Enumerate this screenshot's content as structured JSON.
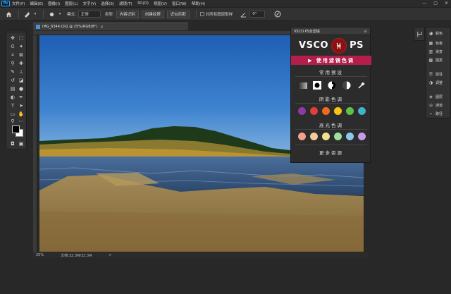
{
  "menubar": {
    "logo": "Ps",
    "items": [
      "文件(F)",
      "编辑(E)",
      "图像(I)",
      "图层(L)",
      "文字(Y)",
      "选择(S)",
      "滤镜(T)",
      "3D(D)",
      "视图(V)",
      "窗口(W)",
      "帮助(H)"
    ],
    "controls": [
      "—",
      "▢",
      "✕"
    ]
  },
  "options": {
    "mode_label": "模式:",
    "mode_value": "正常",
    "type_label": "类型:",
    "type_buttons": [
      "内容识别",
      "创建纹理",
      "近似匹配"
    ],
    "sample_all_label": "对所有图层取样",
    "angle_value": "0°"
  },
  "document": {
    "title": "IMG_6344.CR2 @ 25%(RGB/8*)",
    "close": "×",
    "zoom": "25%",
    "doc_info": "文档:32.3M/32.3M",
    "arrow": ">"
  },
  "vsco": {
    "tab_title": "VSCO PS全滤镜",
    "menu_icon": "≡",
    "brand_left": "VSCO",
    "brand_right": "PS",
    "use_button": "▶ 使用滤镜色调",
    "common_presets": "常用预设",
    "shadow_tones": "阴影色调",
    "highlight_tones": "高光色调",
    "more_resources": "更多资源",
    "shadow_colors": [
      "#8e3aa6",
      "#e53b3b",
      "#f06a1c",
      "#f5c518",
      "#5fc24a",
      "#3fb3c9"
    ],
    "highlight_colors": [
      "#f3a08d",
      "#f7c99a",
      "#f2e08a",
      "#9fe0a0",
      "#8cc8ea",
      "#c79be8"
    ]
  },
  "right_panel": {
    "items": [
      {
        "icon": "color-icon",
        "label": "颜色"
      },
      {
        "icon": "swatches-icon",
        "label": "色板"
      },
      {
        "icon": "gradients-icon",
        "label": "渐变"
      },
      {
        "icon": "patterns-icon",
        "label": "图案"
      },
      {
        "icon": "properties-icon",
        "label": "属性"
      },
      {
        "icon": "adjustments-icon",
        "label": "调整"
      },
      {
        "icon": "layers-icon",
        "label": "图层"
      },
      {
        "icon": "channels-icon",
        "label": "通道"
      },
      {
        "icon": "paths-icon",
        "label": "路径"
      }
    ]
  }
}
